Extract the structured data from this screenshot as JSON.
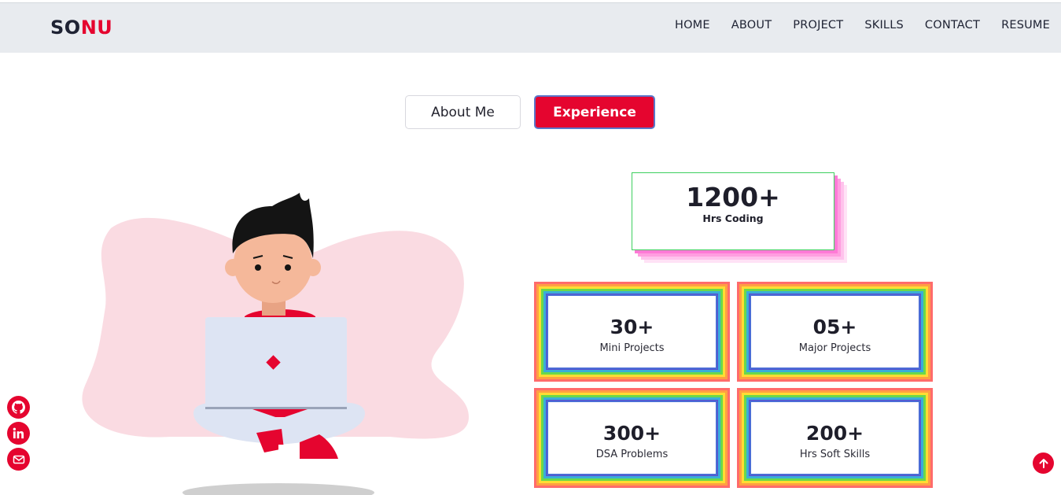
{
  "brand": {
    "part1": "SO",
    "part2": "NU"
  },
  "nav": {
    "home": "HOME",
    "about": "ABOUT",
    "project": "PROJECT",
    "skills": "SKILLS",
    "contact": "CONTACT",
    "resume": "RESUME"
  },
  "tabs": {
    "about": "About Me",
    "experience": "Experience",
    "active": "Experience"
  },
  "stats": {
    "coding": {
      "value": "1200+",
      "label": "Hrs Coding"
    },
    "mini": {
      "value": "30+",
      "label": "Mini Projects"
    },
    "major": {
      "value": "05+",
      "label": "Major Projects"
    },
    "dsa": {
      "value": "300+",
      "label": "DSA Problems"
    },
    "soft": {
      "value": "200+",
      "label": "Hrs Soft Skills"
    }
  },
  "social": [
    "github-icon",
    "linkedin-icon",
    "mail-icon"
  ],
  "colors": {
    "accent": "#e5052f",
    "navbar": "#e8ebef",
    "blob": "#fadbe2",
    "text": "#1e2233"
  }
}
